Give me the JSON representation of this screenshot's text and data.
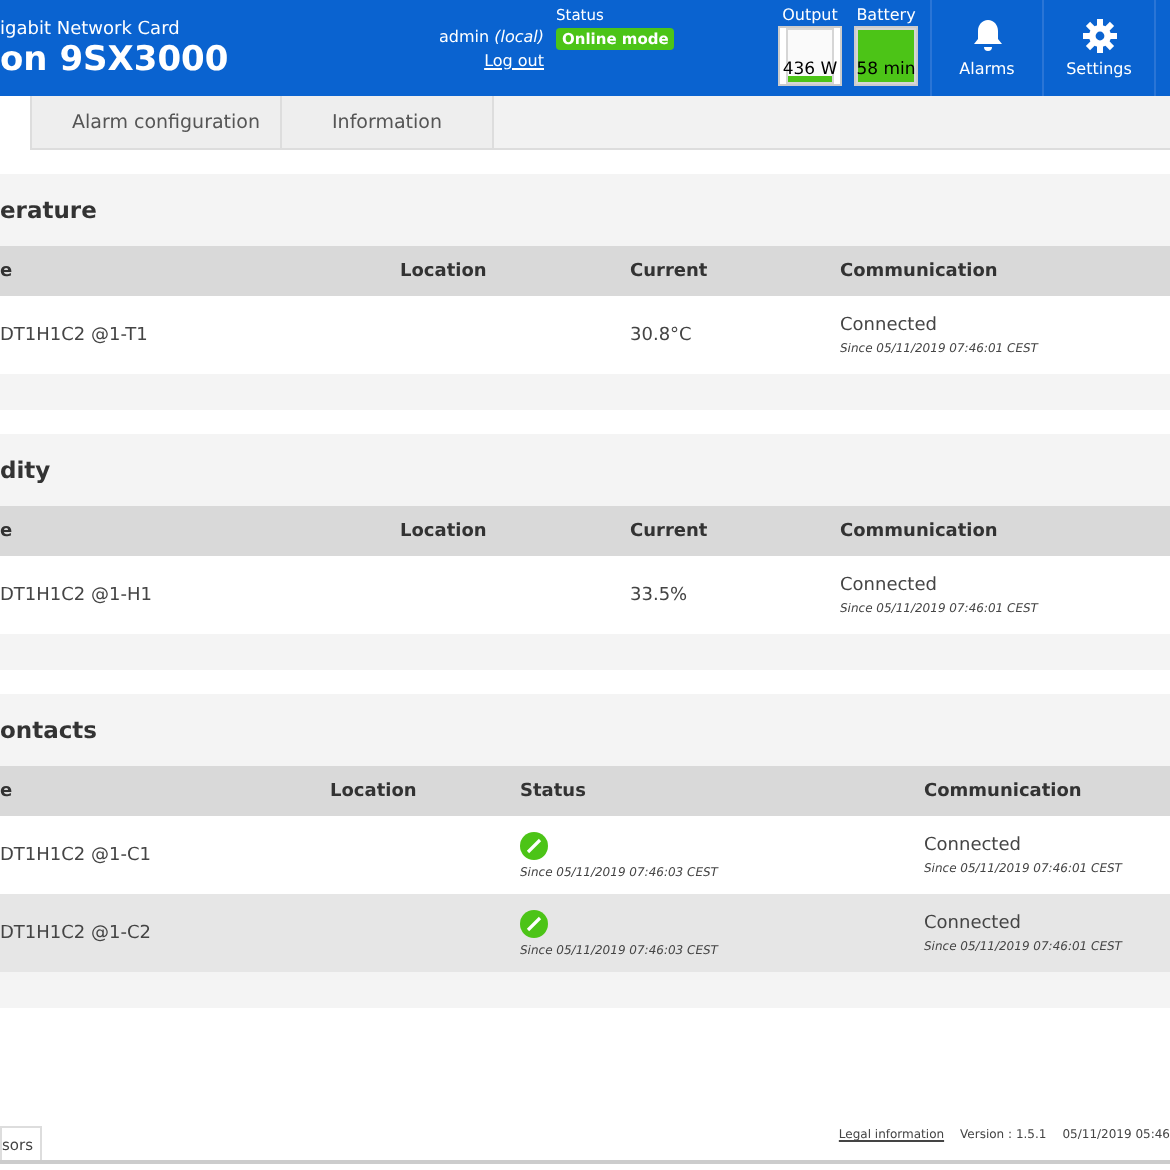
{
  "header": {
    "subtitle": "igabit Network Card",
    "title": "on 9SX3000",
    "user": "admin",
    "user_source": "(local)",
    "logout": "Log out",
    "status_label": "Status",
    "status_badge": "Online mode",
    "gauges": [
      {
        "label": "Output",
        "value": "436 W",
        "level": 0.12
      },
      {
        "label": "Battery",
        "value": "58 min",
        "level": 1
      }
    ],
    "buttons": [
      {
        "label": "Alarms"
      },
      {
        "label": "Settings"
      }
    ]
  },
  "tabs": [
    {
      "selected": true
    },
    {
      "label": "Alarm configuration",
      "selected": false
    },
    {
      "label": "Information",
      "selected": false
    }
  ],
  "sections": [
    {
      "title": "erature",
      "columns": [
        "e",
        "Location",
        "Current",
        "Communication"
      ],
      "kind": "measure",
      "rows": [
        {
          "name": "DT1H1C2 @1-T1",
          "location": "",
          "value": "30.8°C",
          "communication": "Connected",
          "since": "Since 05/11/2019 07:46:01 CEST"
        }
      ]
    },
    {
      "title": "dity",
      "columns": [
        "e",
        "Location",
        "Current",
        "Communication"
      ],
      "kind": "measure",
      "rows": [
        {
          "name": "DT1H1C2 @1-H1",
          "location": "",
          "value": "33.5%",
          "communication": "Connected",
          "since": "Since 05/11/2019 07:46:01 CEST"
        }
      ]
    },
    {
      "title": "ontacts",
      "columns": [
        "e",
        "Location",
        "Status",
        "Communication"
      ],
      "kind": "contact",
      "rows": [
        {
          "name": "DT1H1C2 @1-C1",
          "location": "",
          "status_since": "Since 05/11/2019 07:46:03 CEST",
          "communication": "Connected",
          "since": "Since 05/11/2019 07:46:01 CEST"
        },
        {
          "name": "DT1H1C2 @1-C2",
          "location": "",
          "status_since": "Since 05/11/2019 07:46:03 CEST",
          "communication": "Connected",
          "since": "Since 05/11/2019 07:46:01 CEST"
        }
      ]
    }
  ],
  "bottom_tab": "sors",
  "footer": {
    "legal": "Legal information",
    "version": "Version : 1.5.1",
    "datetime": "05/11/2019 05:46"
  }
}
